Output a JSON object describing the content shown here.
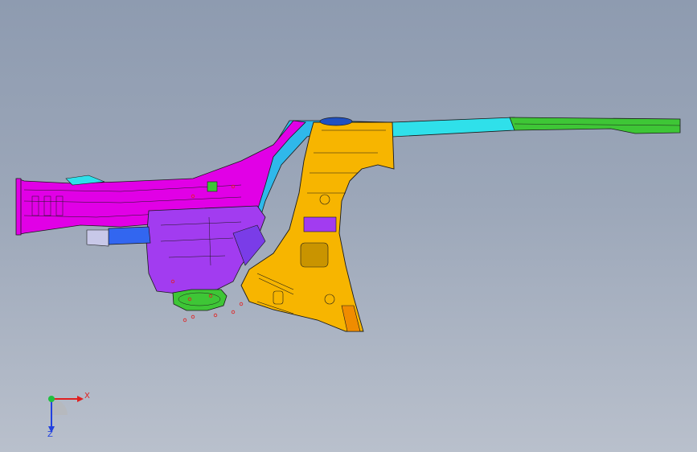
{
  "viewport": {
    "background_top": "#8e9bb0",
    "background_bottom": "#b9c0cc"
  },
  "model": {
    "description_colors": {
      "magenta": "#e100e6",
      "violet": "#a23cf0",
      "orange": "#f7b500",
      "cyan": "#2fe0ea",
      "green": "#3ec636",
      "blue": "#3266f0",
      "edge": "#1a1a1a"
    }
  },
  "triad": {
    "x_label": "X",
    "z_label": "Z",
    "x_color": "#e02020",
    "z_color": "#2040e0",
    "y_color": "#20c040"
  }
}
